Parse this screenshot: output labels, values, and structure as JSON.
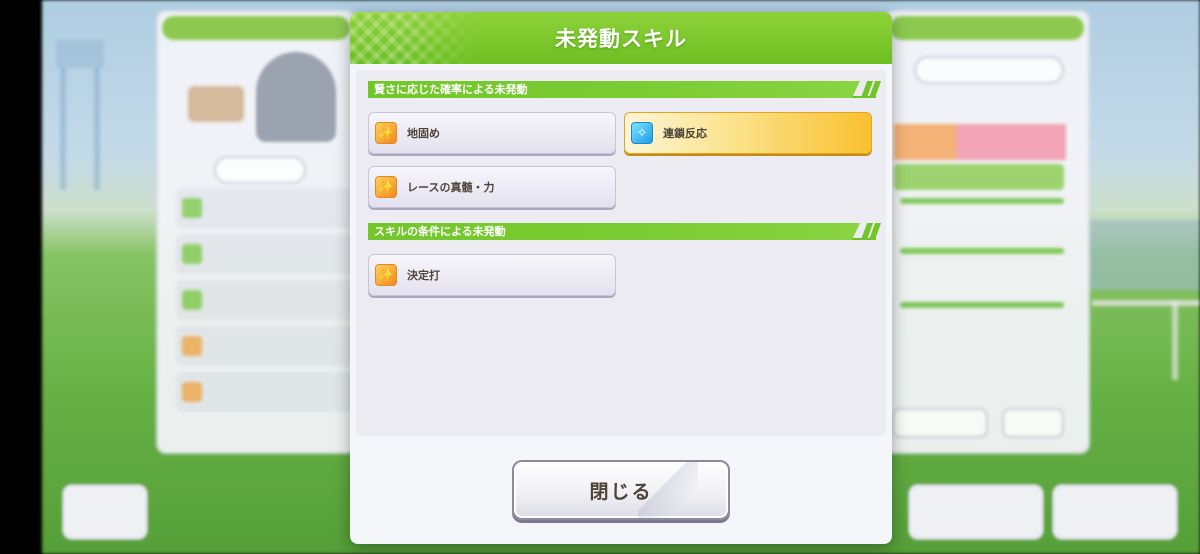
{
  "modal": {
    "title": "未発動スキル",
    "sections": [
      {
        "header": "賢さに応じた確率による未発動",
        "skills": [
          {
            "name": "地固め",
            "icon": "running-shoe-icon",
            "rarity": "normal"
          },
          {
            "name": "連鎖反応",
            "icon": "sparkle-icon",
            "rarity": "gold"
          },
          {
            "name": "レースの真髄・力",
            "icon": "running-shoe-icon",
            "rarity": "normal"
          }
        ]
      },
      {
        "header": "スキルの条件による未発動",
        "skills": [
          {
            "name": "決定打",
            "icon": "running-shoe-icon",
            "rarity": "normal"
          }
        ]
      }
    ],
    "close_label": "閉じる"
  },
  "colors": {
    "header_green": "#6cbf22",
    "gold_skill": "#f9c02f",
    "text_brown": "#4d4339"
  }
}
